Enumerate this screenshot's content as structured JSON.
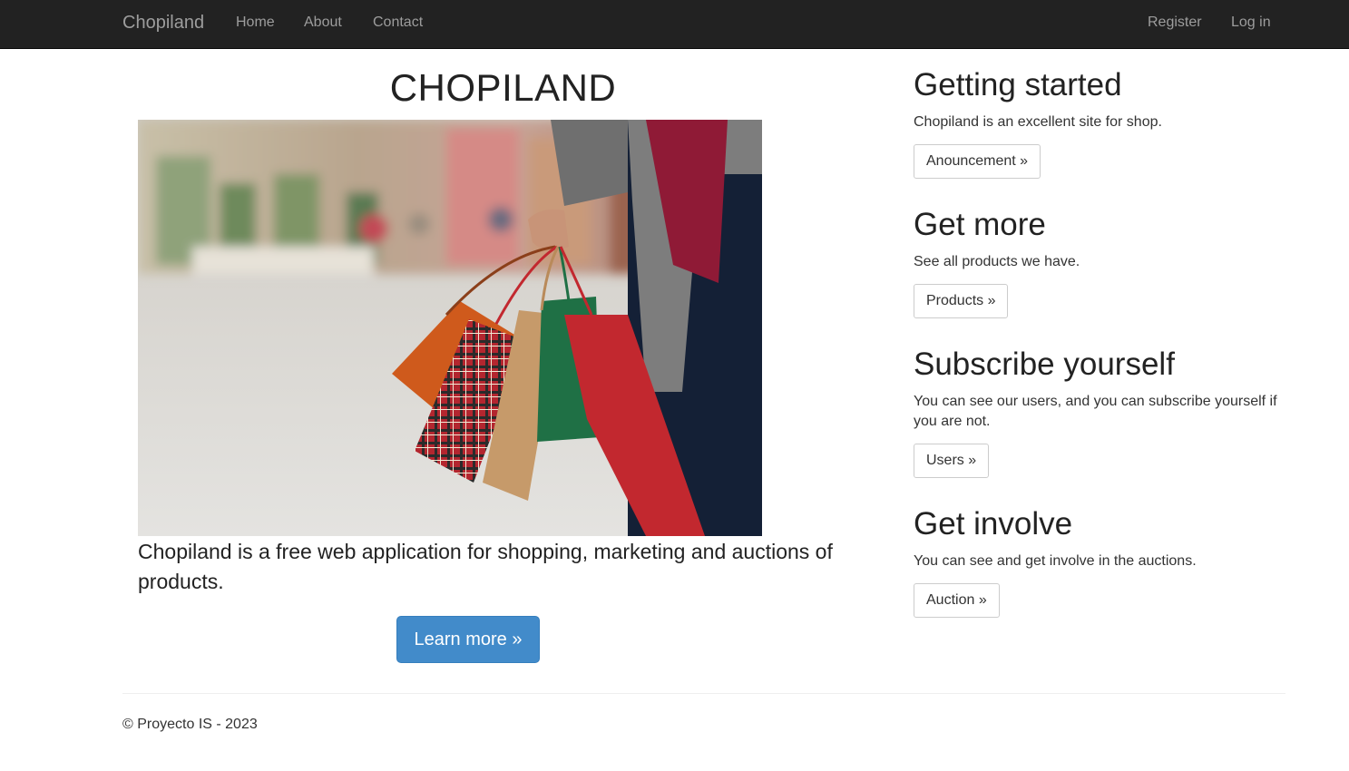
{
  "navbar": {
    "brand": "Chopiland",
    "links": [
      "Home",
      "About",
      "Contact"
    ],
    "register": "Register",
    "login": "Log in"
  },
  "hero": {
    "title": "CHOPILAND",
    "image_alt": "Shopping bags",
    "lead": "Chopiland is a free web application for shopping, marketing and auctions of products.",
    "button": "Learn more »"
  },
  "sections": [
    {
      "title": "Getting started",
      "text": "Chopiland is an excellent site for shop.",
      "button": "Anouncement »"
    },
    {
      "title": "Get more",
      "text": "See all products we have.",
      "button": "Products »"
    },
    {
      "title": "Subscribe yourself",
      "text": "You can see our users, and you can subscribe yourself if you are not.",
      "button": "Users »"
    },
    {
      "title": "Get involve",
      "text": "You can see and get involve in the auctions.",
      "button": "Auction »"
    }
  ],
  "footer": {
    "text": "© Proyecto IS - 2023"
  },
  "colors": {
    "navbar_bg": "#222222",
    "nav_text": "#9d9d9d",
    "primary": "#428bca"
  }
}
